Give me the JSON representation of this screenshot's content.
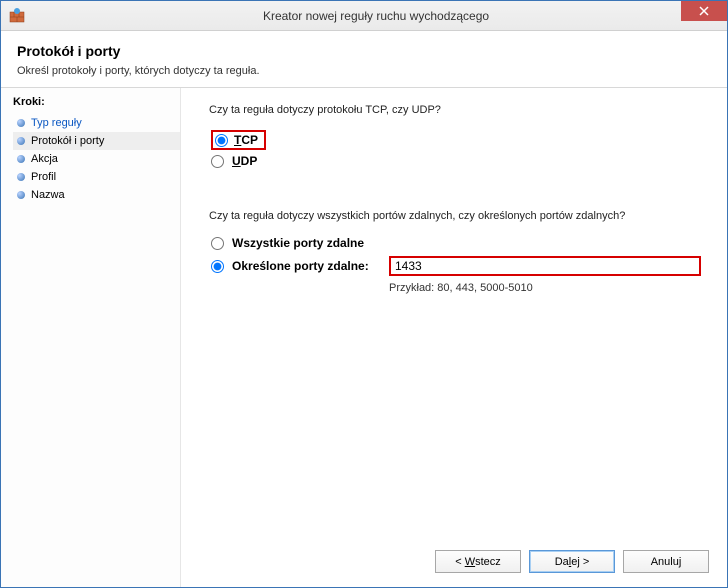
{
  "window": {
    "title": "Kreator nowej reguły ruchu wychodzącego"
  },
  "header": {
    "title": "Protokół i porty",
    "subtitle": "Określ protokoły i porty, których dotyczy ta reguła."
  },
  "steps": {
    "heading": "Kroki:",
    "items": [
      {
        "label": "Typ reguły",
        "link": true
      },
      {
        "label": "Protokół i porty",
        "current": true
      },
      {
        "label": "Akcja"
      },
      {
        "label": "Profil"
      },
      {
        "label": "Nazwa"
      }
    ]
  },
  "protocol": {
    "question": "Czy ta reguła dotyczy protokołu TCP, czy UDP?",
    "options": {
      "tcp": {
        "mnemonic": "T",
        "rest": "CP",
        "selected": true
      },
      "udp": {
        "mnemonic": "U",
        "rest": "DP",
        "selected": false
      }
    }
  },
  "ports": {
    "question": "Czy ta reguła dotyczy wszystkich portów zdalnych, czy określonych portów zdalnych?",
    "options": {
      "all": {
        "mnemonic": "W",
        "rest": "szystkie porty zdalne",
        "selected": false
      },
      "specific": {
        "mnemonic": "O",
        "rest": "kreślone porty zdalne:",
        "selected": true
      }
    },
    "value": "1433",
    "example": "Przykład: 80, 443, 5000-5010"
  },
  "buttons": {
    "back": {
      "prefix": "< ",
      "mnemonic": "W",
      "rest": "stecz"
    },
    "next": {
      "prefix": "Da",
      "mnemonic": "l",
      "rest": "ej >"
    },
    "cancel": {
      "label": "Anuluj"
    }
  }
}
